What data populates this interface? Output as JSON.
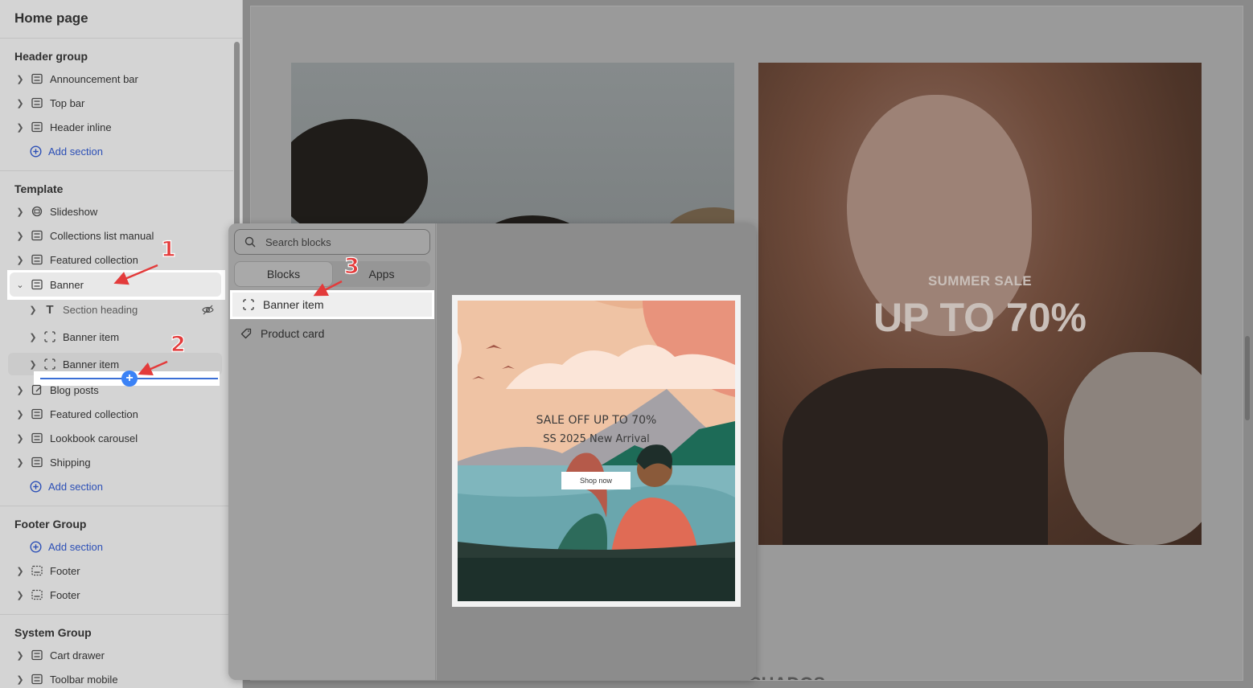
{
  "sidebar": {
    "title": "Home page",
    "header_group": {
      "title": "Header group",
      "items": [
        {
          "label": "Announcement bar",
          "icon": "section-icon"
        },
        {
          "label": "Top bar",
          "icon": "section-icon"
        },
        {
          "label": "Header inline",
          "icon": "section-icon"
        }
      ],
      "add_label": "Add section"
    },
    "template": {
      "title": "Template",
      "items": [
        {
          "label": "Slideshow",
          "icon": "slideshow-icon"
        },
        {
          "label": "Collections list manual",
          "icon": "section-icon"
        },
        {
          "label": "Featured collection",
          "icon": "section-icon"
        },
        {
          "label": "Banner",
          "icon": "section-icon"
        }
      ],
      "banner_children": [
        {
          "label": "Section heading",
          "icon": "text-icon"
        },
        {
          "label": "Banner item",
          "icon": "block-icon"
        },
        {
          "label": "Banner item",
          "icon": "block-icon"
        }
      ],
      "items_after": [
        {
          "label": "Blog posts",
          "icon": "blog-icon"
        },
        {
          "label": "Featured collection",
          "icon": "section-icon"
        },
        {
          "label": "Lookbook carousel",
          "icon": "section-icon"
        },
        {
          "label": "Shipping",
          "icon": "section-icon"
        }
      ],
      "add_label": "Add section"
    },
    "footer_group": {
      "title": "Footer Group",
      "add_label": "Add section",
      "items": [
        {
          "label": "Footer",
          "icon": "footer-icon"
        },
        {
          "label": "Footer",
          "icon": "footer-icon"
        }
      ]
    },
    "system_group": {
      "title": "System Group",
      "items": [
        {
          "label": "Cart drawer",
          "icon": "section-icon"
        },
        {
          "label": "Toolbar mobile",
          "icon": "section-icon"
        }
      ]
    }
  },
  "picker": {
    "search_placeholder": "Search blocks",
    "tabs": [
      "Blocks",
      "Apps"
    ],
    "blocks": [
      {
        "label": "Banner item",
        "icon": "block-icon",
        "selected": true
      },
      {
        "label": "Product card",
        "icon": "tag-icon"
      }
    ],
    "preview": {
      "line1": "SALE OFF UP TO 70%",
      "line2": "SS 2025 New Arrival",
      "button": "Shop now"
    }
  },
  "preview": {
    "sale_small": "SUMMER SALE",
    "sale_big": "UP TO 70%",
    "bottom_partial": "SHADOS"
  },
  "annotations": [
    "1",
    "2",
    "3"
  ],
  "colors": {
    "accent_blue": "#2c4fb6",
    "annotation_red": "#e33b3b",
    "insert_blue": "#3b82f6"
  }
}
